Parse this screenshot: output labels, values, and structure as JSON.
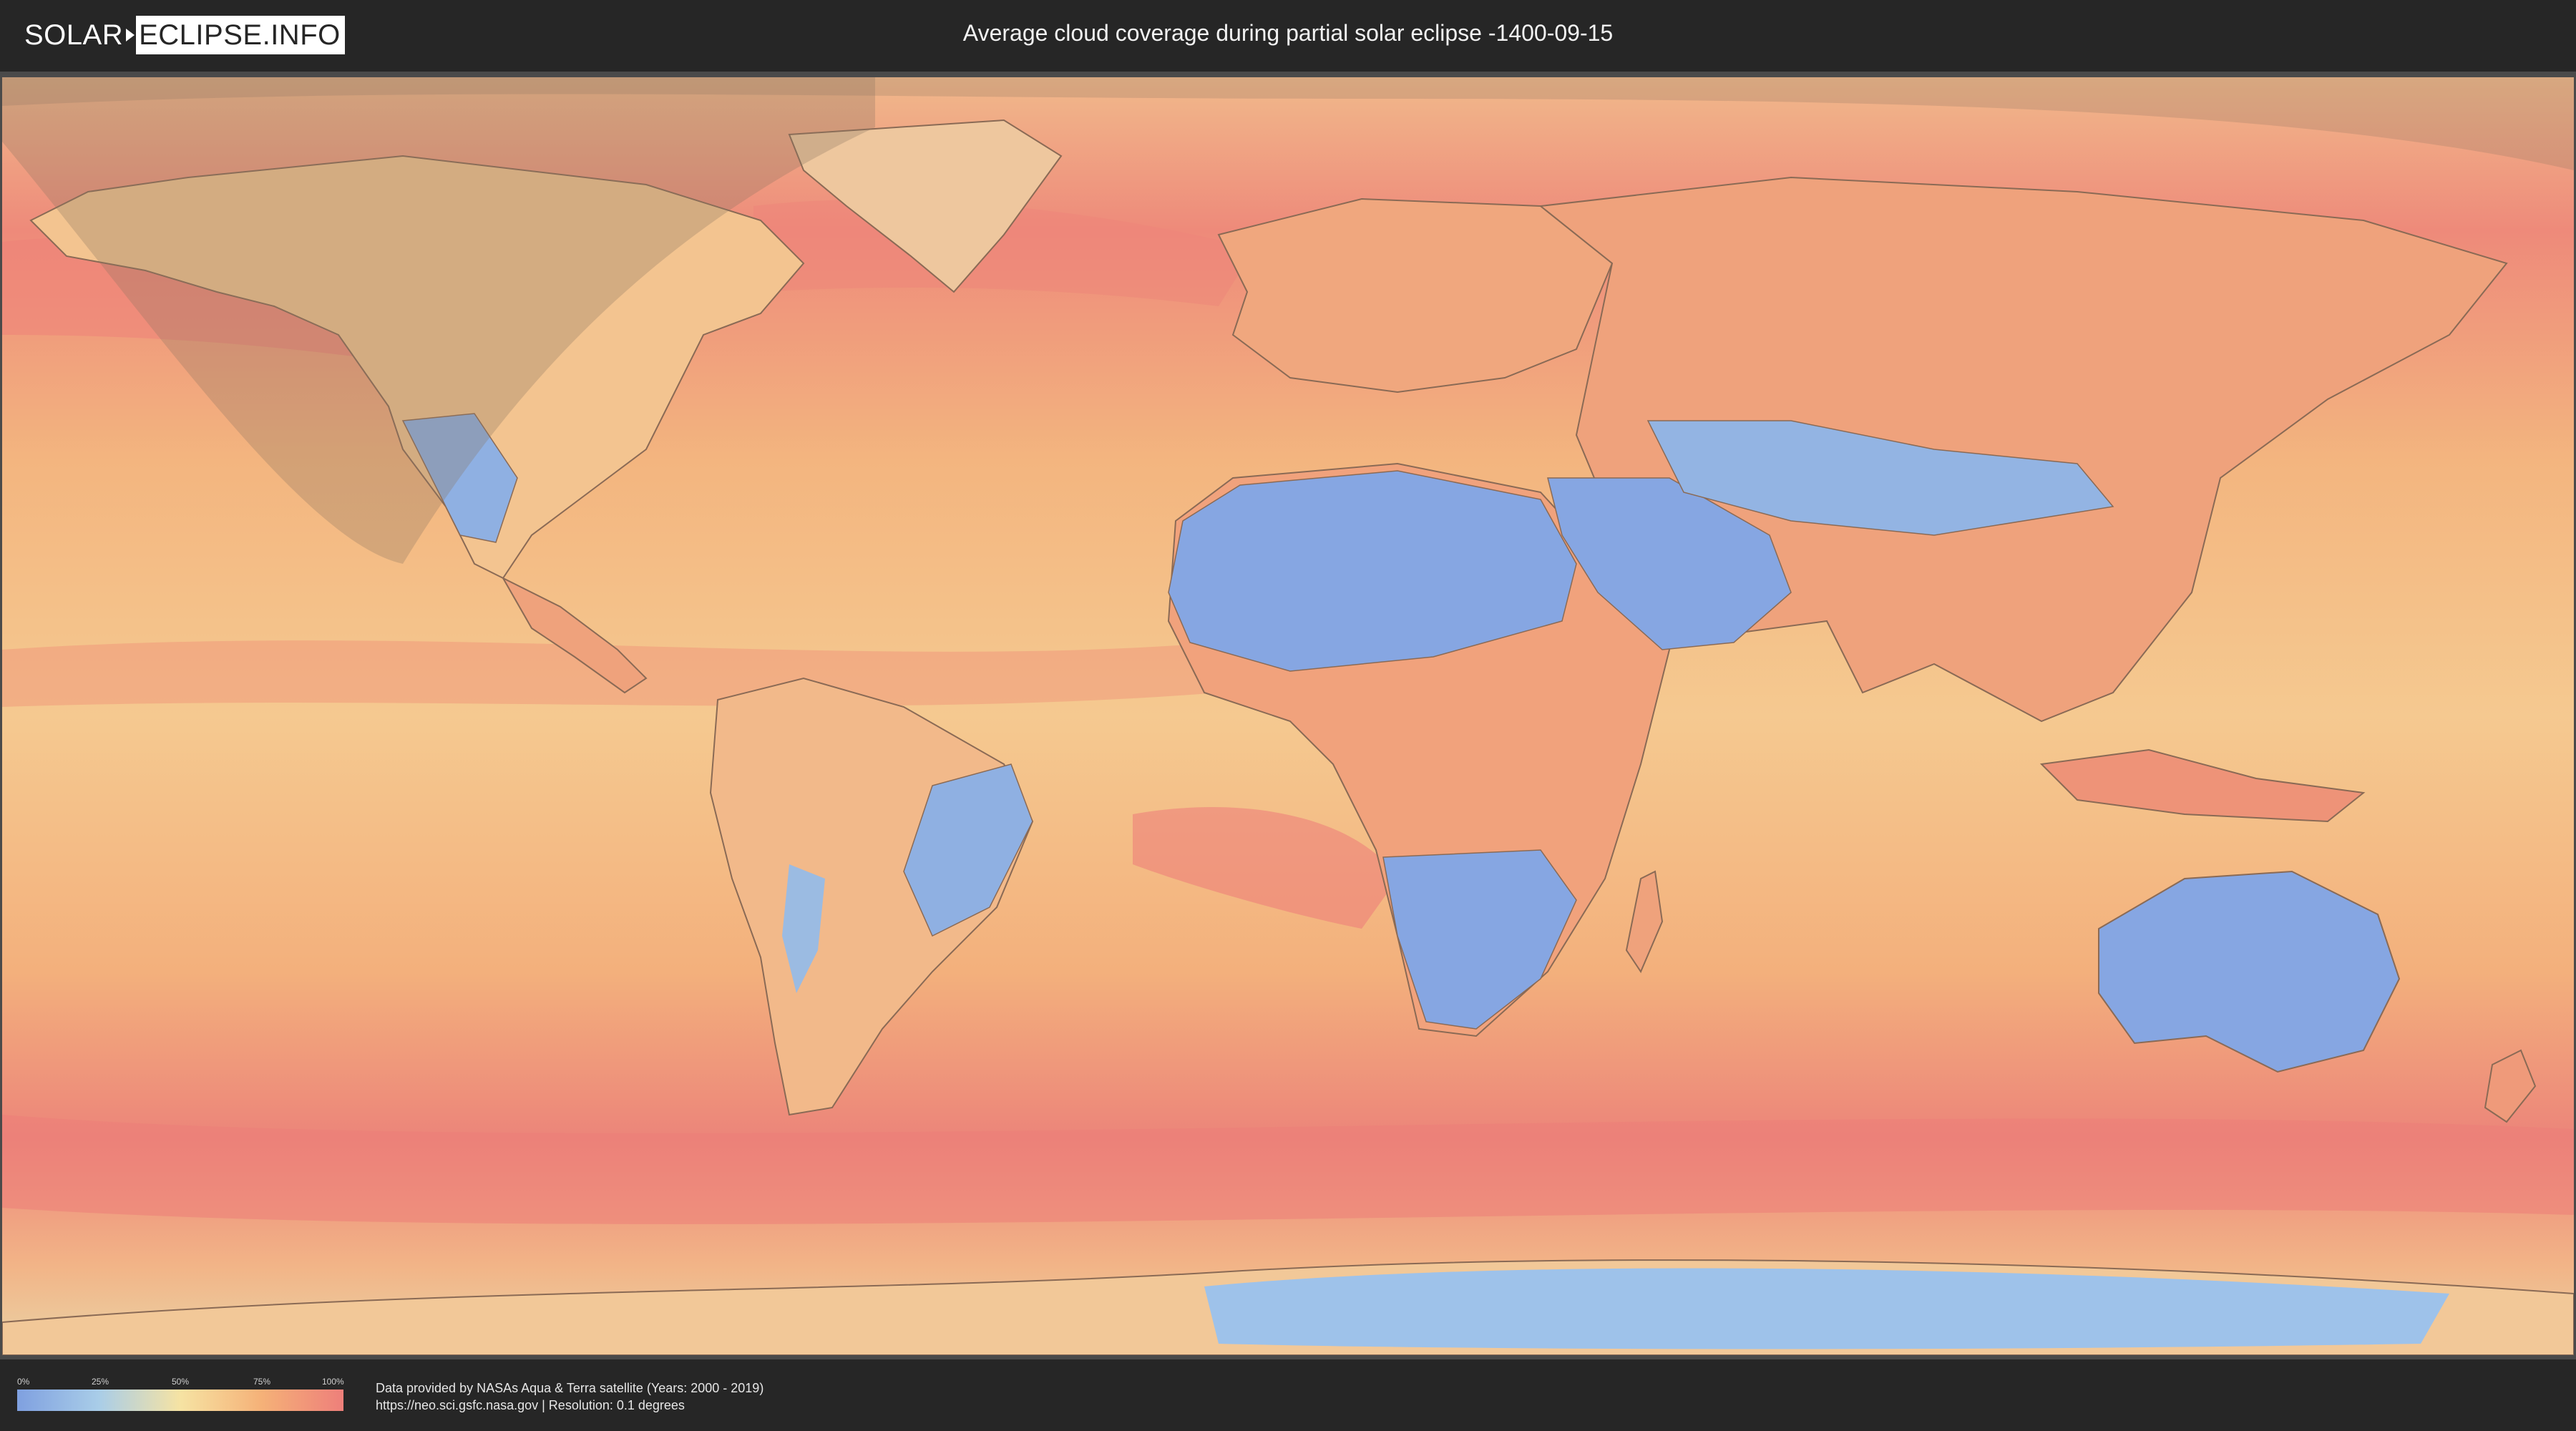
{
  "header": {
    "logo_left": "SOLAR",
    "logo_right": "ECLIPSE.INFO",
    "title": "Average cloud coverage during partial solar eclipse -1400-09-15"
  },
  "map": {
    "ocean_color": "#f0a07a",
    "land_color": "#f3c690",
    "clear_color": "#7fa0e0",
    "border_color": "#8a6a55",
    "eclipse_shade_color": "#8a7560",
    "regions": [
      "North America",
      "Greenland",
      "South America",
      "Africa",
      "Europe",
      "Asia",
      "Australia",
      "Antarctica",
      "Madagascar",
      "New Zealand"
    ]
  },
  "legend": {
    "ticks": [
      "0%",
      "25%",
      "50%",
      "75%",
      "100%"
    ],
    "gradient": [
      "#7fa0e0",
      "#a9cde8",
      "#f6e3a3",
      "#f5b178",
      "#ee7f7a"
    ]
  },
  "footer": {
    "source_line1": "Data provided by NASAs Aqua & Terra satellite (Years: 2000 - 2019)",
    "source_line2": "https://neo.sci.gsfc.nasa.gov | Resolution: 0.1 degrees"
  }
}
